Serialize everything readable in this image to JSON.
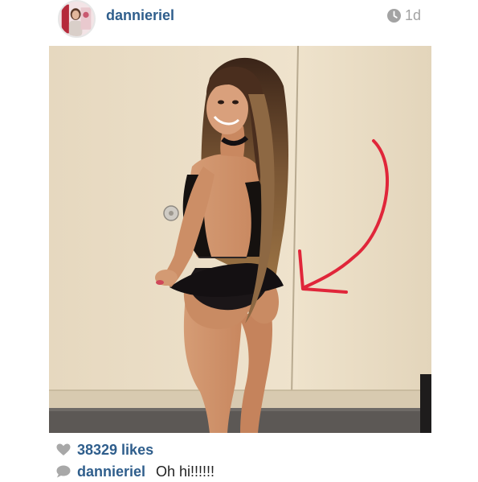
{
  "post": {
    "username": "dannieriel",
    "time_ago": "1d",
    "likes_text": "38329 likes",
    "caption_user": "dannieriel",
    "caption_text": "Oh hi!!!!!!"
  },
  "icons": {
    "clock": "clock-icon",
    "heart": "heart-icon",
    "comment": "comment-bubble-icon"
  },
  "colors": {
    "username": "#2f5e8c",
    "timestamp": "#a3a3a3",
    "annotation_arrow": "#e0263a",
    "wall": "#e9dcc4",
    "floor": "#5c5855"
  }
}
